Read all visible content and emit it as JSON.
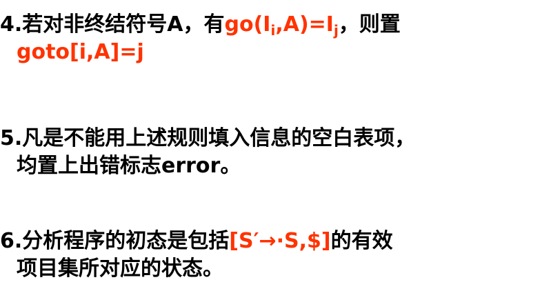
{
  "items": [
    {
      "number": "4.",
      "line1_text": "若对非终结符号A，有",
      "line1_formula": {
        "prefix": "go(I",
        "sub1": "i",
        "middle": ",A)=I",
        "sub2": "j"
      },
      "line1_suffix": "，则置",
      "line2_formula": "goto[i,A]=j"
    },
    {
      "number": "5.",
      "line1_text": "凡是不能用上述规则填入信息的空白表项，",
      "line2_text": "均置上出错标志",
      "line2_keyword": "error",
      "line2_end": "。"
    },
    {
      "number": "6.",
      "line1_text": "分析程序的初态是包括",
      "line1_formula": "[S′→·S,$]",
      "line1_suffix": "的有效",
      "line2_text": "项目集所对应的状态。"
    }
  ],
  "colors": {
    "text": "#000000",
    "highlight": "#ff3300",
    "background": "#ffffff"
  }
}
